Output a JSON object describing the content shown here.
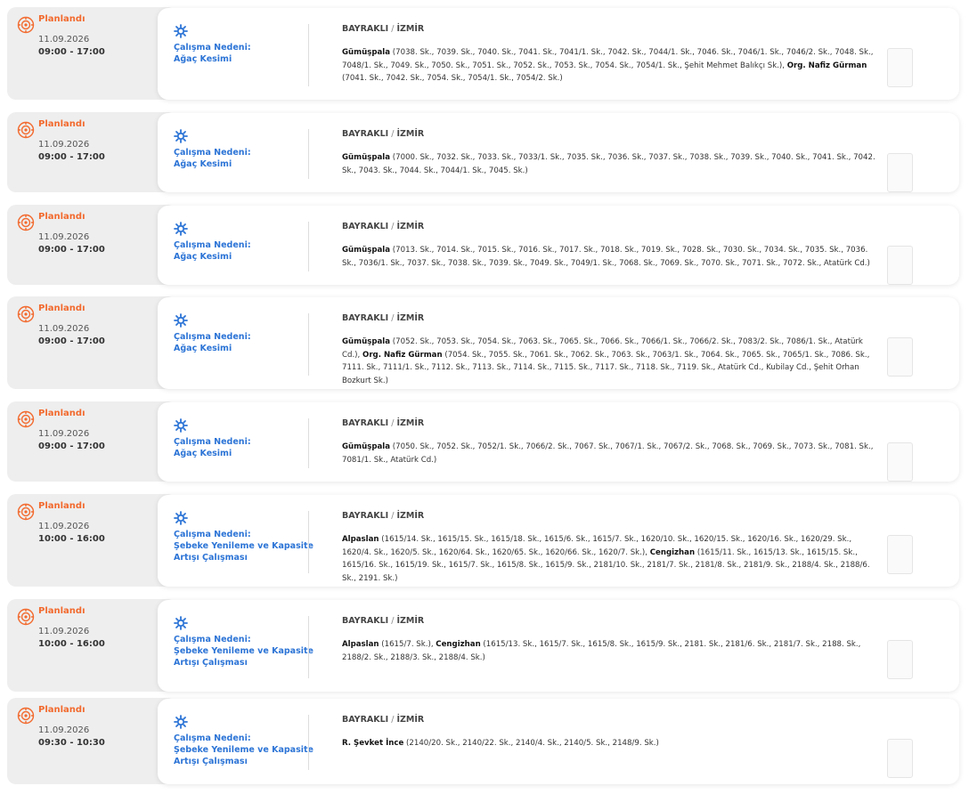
{
  "colors": {
    "status": "#f26a2e",
    "reason": "#2c74d6"
  },
  "icons": {
    "status": "outage-gear-icon",
    "reason": "maintenance-gear-icon"
  },
  "reason_prefix": "Çalışma Nedeni:",
  "outages": [
    {
      "status": "Planlandı",
      "date": "11.09.2026",
      "time": "09:00 - 17:00",
      "reason": "Ağaç Kesimi",
      "district": "BAYRAKLI",
      "city": "İZMİR",
      "groups": [
        {
          "name": "Gümüşpala",
          "streets": "(7038. Sk., 7039. Sk., 7040. Sk., 7041. Sk., 7041/1. Sk., 7042. Sk., 7044/1. Sk., 7046. Sk., 7046/1. Sk., 7046/2. Sk., 7048. Sk., 7048/1. Sk., 7049. Sk., 7050. Sk., 7051. Sk., 7052. Sk., 7053. Sk., 7054. Sk., 7054/1. Sk., Şehit Mehmet Balıkçı Sk.)"
        },
        {
          "name": "Org. Nafiz Gürman",
          "streets": "(7041. Sk., 7042. Sk., 7054. Sk., 7054/1. Sk., 7054/2. Sk.)"
        }
      ]
    },
    {
      "status": "Planlandı",
      "date": "11.09.2026",
      "time": "09:00 - 17:00",
      "reason": "Ağaç Kesimi",
      "district": "BAYRAKLI",
      "city": "İZMİR",
      "groups": [
        {
          "name": "Gümüşpala",
          "streets": "(7000. Sk., 7032. Sk., 7033. Sk., 7033/1. Sk., 7035. Sk., 7036. Sk., 7037. Sk., 7038. Sk., 7039. Sk., 7040. Sk., 7041. Sk., 7042. Sk., 7043. Sk., 7044. Sk., 7044/1. Sk., 7045. Sk.)"
        }
      ]
    },
    {
      "status": "Planlandı",
      "date": "11.09.2026",
      "time": "09:00 - 17:00",
      "reason": "Ağaç Kesimi",
      "district": "BAYRAKLI",
      "city": "İZMİR",
      "groups": [
        {
          "name": "Gümüşpala",
          "streets": "(7013. Sk., 7014. Sk., 7015. Sk., 7016. Sk., 7017. Sk., 7018. Sk., 7019. Sk., 7028. Sk., 7030. Sk., 7034. Sk., 7035. Sk., 7036. Sk., 7036/1. Sk., 7037. Sk., 7038. Sk., 7039. Sk., 7049. Sk., 7049/1. Sk., 7068. Sk., 7069. Sk., 7070. Sk., 7071. Sk., 7072. Sk., Atatürk Cd.)"
        }
      ]
    },
    {
      "status": "Planlandı",
      "date": "11.09.2026",
      "time": "09:00 - 17:00",
      "reason": "Ağaç Kesimi",
      "district": "BAYRAKLI",
      "city": "İZMİR",
      "groups": [
        {
          "name": "Gümüşpala",
          "streets": "(7052. Sk., 7053. Sk., 7054. Sk., 7063. Sk., 7065. Sk., 7066. Sk., 7066/1. Sk., 7066/2. Sk., 7083/2. Sk., 7086/1. Sk., Atatürk Cd.)"
        },
        {
          "name": "Org. Nafiz Gürman",
          "streets": "(7054. Sk., 7055. Sk., 7061. Sk., 7062. Sk., 7063. Sk., 7063/1. Sk., 7064. Sk., 7065. Sk., 7065/1. Sk., 7086. Sk., 7111. Sk., 7111/1. Sk., 7112. Sk., 7113. Sk., 7114. Sk., 7115. Sk., 7117. Sk., 7118. Sk., 7119. Sk., Atatürk Cd., Kubilay Cd., Şehit Orhan Bozkurt Sk.)"
        }
      ]
    },
    {
      "status": "Planlandı",
      "date": "11.09.2026",
      "time": "09:00 - 17:00",
      "reason": "Ağaç Kesimi",
      "district": "BAYRAKLI",
      "city": "İZMİR",
      "groups": [
        {
          "name": "Gümüşpala",
          "streets": "(7050. Sk., 7052. Sk., 7052/1. Sk., 7066/2. Sk., 7067. Sk., 7067/1. Sk., 7067/2. Sk., 7068. Sk., 7069. Sk., 7073. Sk., 7081. Sk., 7081/1. Sk., Atatürk Cd.)"
        }
      ]
    },
    {
      "status": "Planlandı",
      "date": "11.09.2026",
      "time": "10:00 - 16:00",
      "reason": "Şebeke Yenileme ve Kapasite Artışı Çalışması",
      "district": "BAYRAKLI",
      "city": "İZMİR",
      "groups": [
        {
          "name": "Alpaslan",
          "streets": "(1615/14. Sk., 1615/15. Sk., 1615/18. Sk., 1615/6. Sk., 1615/7. Sk., 1620/10. Sk., 1620/15. Sk., 1620/16. Sk., 1620/29. Sk., 1620/4. Sk., 1620/5. Sk., 1620/64. Sk., 1620/65. Sk., 1620/66. Sk., 1620/7. Sk.)"
        },
        {
          "name": "Cengizhan",
          "streets": "(1615/11. Sk., 1615/13. Sk., 1615/15. Sk., 1615/16. Sk., 1615/19. Sk., 1615/7. Sk., 1615/8. Sk., 1615/9. Sk., 2181/10. Sk., 2181/7. Sk., 2181/8. Sk., 2181/9. Sk., 2188/4. Sk., 2188/6. Sk., 2191. Sk.)"
        }
      ]
    },
    {
      "status": "Planlandı",
      "date": "11.09.2026",
      "time": "10:00 - 16:00",
      "reason": "Şebeke Yenileme ve Kapasite Artışı Çalışması",
      "district": "BAYRAKLI",
      "city": "İZMİR",
      "groups": [
        {
          "name": "Alpaslan",
          "streets": "(1615/7. Sk.)"
        },
        {
          "name": "Cengizhan",
          "streets": "(1615/13. Sk., 1615/7. Sk., 1615/8. Sk., 1615/9. Sk., 2181. Sk., 2181/6. Sk., 2181/7. Sk., 2188. Sk., 2188/2. Sk., 2188/3. Sk., 2188/4. Sk.)"
        }
      ]
    },
    {
      "status": "Planlandı",
      "date": "11.09.2026",
      "time": "09:30 - 10:30",
      "reason": "Şebeke Yenileme ve Kapasite Artışı Çalışması",
      "district": "BAYRAKLI",
      "city": "İZMİR",
      "groups": [
        {
          "name": "R. Şevket İnce",
          "streets": "(2140/20. Sk., 2140/22. Sk., 2140/4. Sk., 2140/5. Sk., 2148/9. Sk.)"
        }
      ]
    }
  ]
}
